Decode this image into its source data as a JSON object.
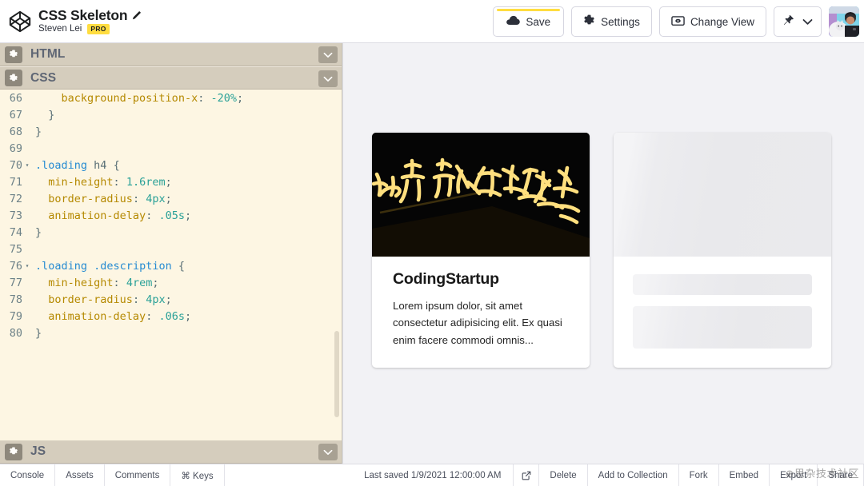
{
  "header": {
    "logo_icon": "codepen-logo-icon",
    "title": "CSS Skeleton",
    "edit_icon": "pen-edit-icon",
    "username": "Steven Lei",
    "pro_badge": "PRO",
    "buttons": [
      {
        "id": "save",
        "label": "Save",
        "icon": "cloud-icon",
        "unsaved_accent": "#ffdd40"
      },
      {
        "id": "settings",
        "label": "Settings",
        "icon": "gear-icon"
      },
      {
        "id": "change-view",
        "label": "Change View",
        "icon": "view-window-icon"
      }
    ],
    "pin_icon": "pin-icon",
    "pin_chevron_icon": "chevron-down-icon",
    "avatar_alt": "user-avatar"
  },
  "editor": {
    "panes": [
      {
        "id": "html",
        "label": "HTML",
        "gear_icon": "gear-icon",
        "chevron_icon": "chevron-down-icon"
      },
      {
        "id": "css",
        "label": "CSS",
        "gear_icon": "gear-icon",
        "chevron_icon": "chevron-down-icon"
      },
      {
        "id": "js",
        "label": "JS",
        "gear_icon": "gear-icon",
        "chevron_icon": "chevron-down-icon"
      }
    ],
    "language": "CSS",
    "lines": [
      {
        "n": "66",
        "fold": "",
        "tokens": [
          {
            "t": "    ",
            "c": "punc"
          },
          {
            "t": "background-position-x",
            "c": "prop"
          },
          {
            "t": ": ",
            "c": "punc"
          },
          {
            "t": "-20%",
            "c": "val"
          },
          {
            "t": ";",
            "c": "punc"
          }
        ]
      },
      {
        "n": "67",
        "fold": "",
        "tokens": [
          {
            "t": "  }",
            "c": "punc"
          }
        ]
      },
      {
        "n": "68",
        "fold": "",
        "tokens": [
          {
            "t": "}",
            "c": "punc"
          }
        ]
      },
      {
        "n": "69",
        "fold": "",
        "tokens": [
          {
            "t": "",
            "c": "punc"
          }
        ]
      },
      {
        "n": "70",
        "fold": "▾",
        "tokens": [
          {
            "t": ".loading",
            "c": "sel"
          },
          {
            "t": " ",
            "c": "punc"
          },
          {
            "t": "h4",
            "c": "punc"
          },
          {
            "t": " {",
            "c": "punc"
          }
        ]
      },
      {
        "n": "71",
        "fold": "",
        "tokens": [
          {
            "t": "  ",
            "c": "punc"
          },
          {
            "t": "min-height",
            "c": "prop"
          },
          {
            "t": ": ",
            "c": "punc"
          },
          {
            "t": "1.6rem",
            "c": "val"
          },
          {
            "t": ";",
            "c": "punc"
          }
        ]
      },
      {
        "n": "72",
        "fold": "",
        "tokens": [
          {
            "t": "  ",
            "c": "punc"
          },
          {
            "t": "border-radius",
            "c": "prop"
          },
          {
            "t": ": ",
            "c": "punc"
          },
          {
            "t": "4px",
            "c": "val"
          },
          {
            "t": ";",
            "c": "punc"
          }
        ]
      },
      {
        "n": "73",
        "fold": "",
        "tokens": [
          {
            "t": "  ",
            "c": "punc"
          },
          {
            "t": "animation-delay",
            "c": "prop"
          },
          {
            "t": ": ",
            "c": "punc"
          },
          {
            "t": ".05s",
            "c": "val"
          },
          {
            "t": ";",
            "c": "punc"
          }
        ]
      },
      {
        "n": "74",
        "fold": "",
        "tokens": [
          {
            "t": "}",
            "c": "punc"
          }
        ]
      },
      {
        "n": "75",
        "fold": "",
        "tokens": [
          {
            "t": "",
            "c": "punc"
          }
        ]
      },
      {
        "n": "76",
        "fold": "▾",
        "tokens": [
          {
            "t": ".loading",
            "c": "sel"
          },
          {
            "t": " ",
            "c": "punc"
          },
          {
            "t": ".description",
            "c": "sel"
          },
          {
            "t": " {",
            "c": "punc"
          }
        ]
      },
      {
        "n": "77",
        "fold": "",
        "tokens": [
          {
            "t": "  ",
            "c": "punc"
          },
          {
            "t": "min-height",
            "c": "prop"
          },
          {
            "t": ": ",
            "c": "punc"
          },
          {
            "t": "4rem",
            "c": "val"
          },
          {
            "t": ";",
            "c": "punc"
          }
        ]
      },
      {
        "n": "78",
        "fold": "",
        "tokens": [
          {
            "t": "  ",
            "c": "punc"
          },
          {
            "t": "border-radius",
            "c": "prop"
          },
          {
            "t": ": ",
            "c": "punc"
          },
          {
            "t": "4px",
            "c": "val"
          },
          {
            "t": ";",
            "c": "punc"
          }
        ]
      },
      {
        "n": "79",
        "fold": "",
        "tokens": [
          {
            "t": "  ",
            "c": "punc"
          },
          {
            "t": "animation-delay",
            "c": "prop"
          },
          {
            "t": ": ",
            "c": "punc"
          },
          {
            "t": ".06s",
            "c": "val"
          },
          {
            "t": ";",
            "c": "punc"
          }
        ]
      },
      {
        "n": "80",
        "fold": "",
        "tokens": [
          {
            "t": "}",
            "c": "punc"
          }
        ]
      }
    ]
  },
  "preview": {
    "background": "#f2f2f5",
    "cards": [
      {
        "id": "loaded-card",
        "image_alt": "chinese-calligraphy-neon-photo",
        "title": "CodingStartup",
        "description": "Lorem ipsum dolor, sit amet consectetur adipisicing elit. Ex quasi enim facere commodi omnis..."
      },
      {
        "id": "skeleton-card",
        "placeholder_title": "",
        "placeholder_description": ""
      }
    ]
  },
  "bottombar": {
    "left_items": [
      {
        "id": "console",
        "label": "Console"
      },
      {
        "id": "assets",
        "label": "Assets"
      },
      {
        "id": "comments",
        "label": "Comments"
      },
      {
        "id": "keys",
        "label": "⌘ Keys"
      }
    ],
    "last_saved": "Last saved 1/9/2021 12:00:00 AM",
    "open_icon": "external-link-icon",
    "right_items": [
      {
        "id": "delete",
        "label": "Delete"
      },
      {
        "id": "add-to-collection",
        "label": "Add to Collection"
      },
      {
        "id": "fork",
        "label": "Fork"
      },
      {
        "id": "embed",
        "label": "Embed"
      },
      {
        "id": "export",
        "label": "Export"
      },
      {
        "id": "share",
        "label": "Share"
      }
    ],
    "watermark": "⊕思杂技术社区"
  }
}
